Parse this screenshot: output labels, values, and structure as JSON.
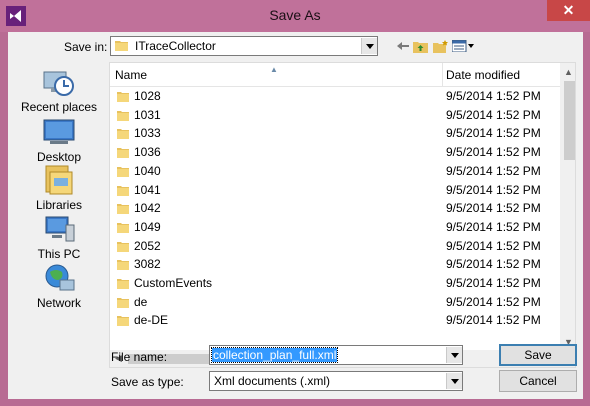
{
  "window": {
    "title": "Save As"
  },
  "save_in": {
    "label": "Save in:",
    "value": "ITraceCollector"
  },
  "places": [
    {
      "label": "Recent places",
      "icon": "recent-places-icon"
    },
    {
      "label": "Desktop",
      "icon": "desktop-icon"
    },
    {
      "label": "Libraries",
      "icon": "libraries-icon"
    },
    {
      "label": "This PC",
      "icon": "this-pc-icon"
    },
    {
      "label": "Network",
      "icon": "network-icon"
    }
  ],
  "file_list": {
    "columns": {
      "name": "Name",
      "date": "Date modified"
    },
    "rows": [
      {
        "name": "1028",
        "date": "9/5/2014 1:52 PM"
      },
      {
        "name": "1031",
        "date": "9/5/2014 1:52 PM"
      },
      {
        "name": "1033",
        "date": "9/5/2014 1:52 PM"
      },
      {
        "name": "1036",
        "date": "9/5/2014 1:52 PM"
      },
      {
        "name": "1040",
        "date": "9/5/2014 1:52 PM"
      },
      {
        "name": "1041",
        "date": "9/5/2014 1:52 PM"
      },
      {
        "name": "1042",
        "date": "9/5/2014 1:52 PM"
      },
      {
        "name": "1049",
        "date": "9/5/2014 1:52 PM"
      },
      {
        "name": "2052",
        "date": "9/5/2014 1:52 PM"
      },
      {
        "name": "3082",
        "date": "9/5/2014 1:52 PM"
      },
      {
        "name": "CustomEvents",
        "date": "9/5/2014 1:52 PM"
      },
      {
        "name": "de",
        "date": "9/5/2014 1:52 PM"
      },
      {
        "name": "de-DE",
        "date": "9/5/2014 1:52 PM"
      }
    ]
  },
  "file_name": {
    "label": "File name:",
    "value": "collection_plan_full.xml"
  },
  "save_as_type": {
    "label": "Save as type:",
    "value": "Xml documents (.xml)"
  },
  "buttons": {
    "save": "Save",
    "cancel": "Cancel"
  },
  "colors": {
    "title_bar": "#c0719a",
    "close_button": "#c84747",
    "selection": "#3399ff",
    "folder": "#e8c25e"
  }
}
